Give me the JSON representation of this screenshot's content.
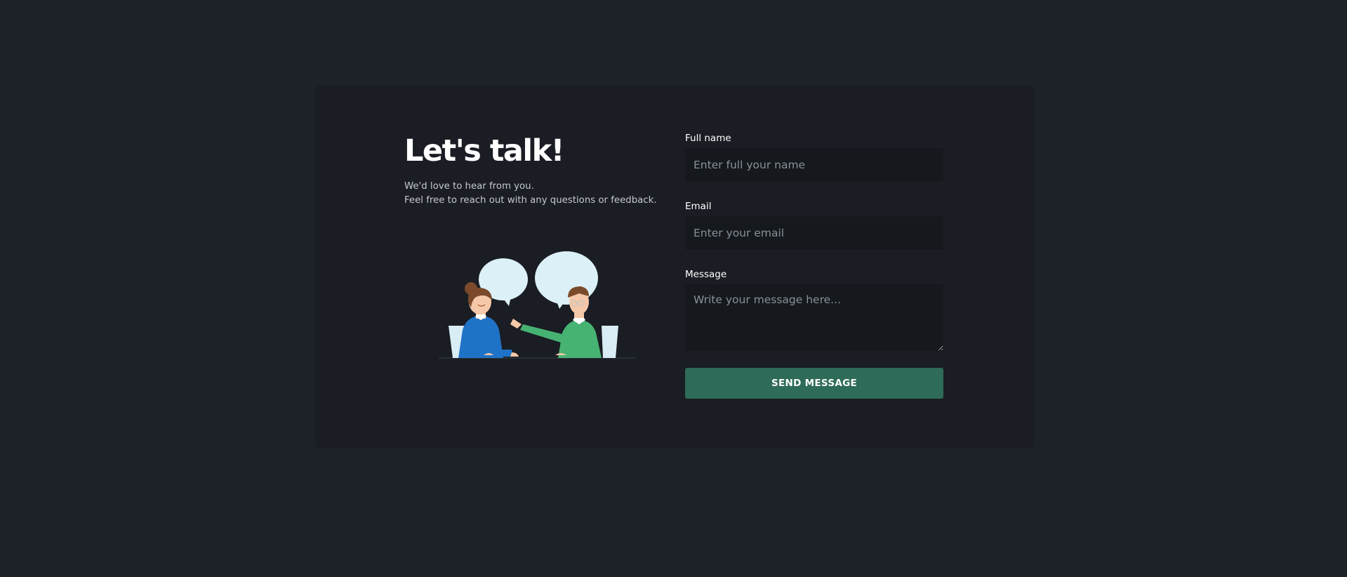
{
  "intro": {
    "title": "Let's talk!",
    "subtitle_line1": "We'd love to hear from you.",
    "subtitle_line2": "Feel free to reach out with any questions or feedback."
  },
  "form": {
    "full_name": {
      "label": "Full name",
      "placeholder": "Enter full your name",
      "value": ""
    },
    "email": {
      "label": "Email",
      "placeholder": "Enter your email",
      "value": ""
    },
    "message": {
      "label": "Message",
      "placeholder": "Write your message here...",
      "value": ""
    },
    "submit_label": "SEND MESSAGE"
  },
  "illustration": {
    "icon": "two-people-chatting-illustration",
    "colors": {
      "bubble": "#dcf0f7",
      "woman_shirt": "#1f73c7",
      "man_shirt": "#46b373",
      "hair": "#7a4a2a",
      "skin": "#f5c8a9"
    }
  },
  "colors": {
    "page_background": "#1d2229",
    "card_background": "#1a1d23",
    "input_background": "#15181c",
    "button": "#2e6b58"
  }
}
